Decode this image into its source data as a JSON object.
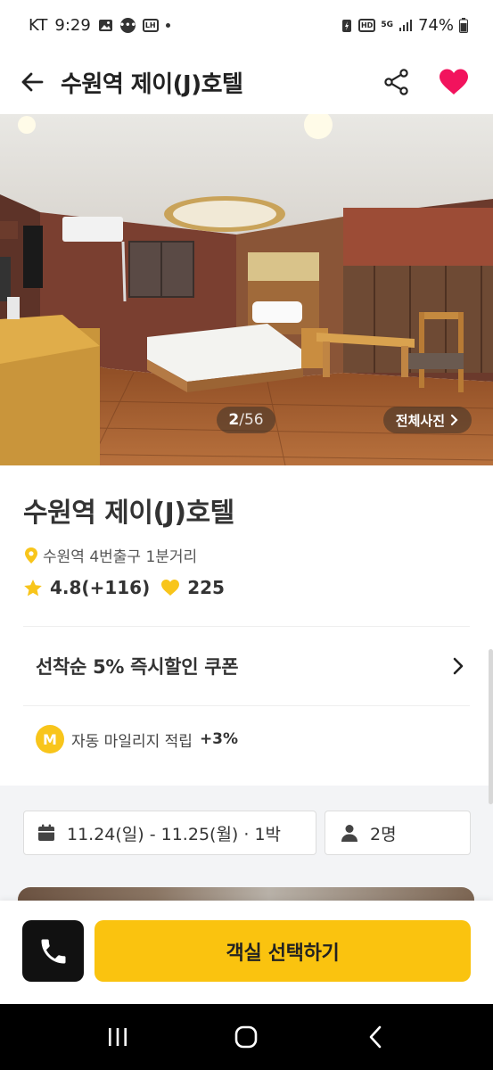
{
  "status_bar": {
    "carrier": "KT",
    "time": "9:29",
    "lh_badge": "LH",
    "hd_badge": "HD",
    "network": "5G",
    "battery": "74%"
  },
  "header": {
    "title": "수원역 제이(J)호텔",
    "favorite_color": "#f2135d"
  },
  "gallery": {
    "current": "2",
    "total": "/56",
    "view_all_label": "전체사진"
  },
  "hotel": {
    "name": "수원역 제이(J)호텔",
    "location": "수원역 4번출구 1분거리",
    "rating": "4.8(+116)",
    "likes": "225"
  },
  "coupon": {
    "label": "선착순 5% 즉시할인 쿠폰"
  },
  "mileage": {
    "badge": "M",
    "label": "자동 마일리지 적립",
    "value": "+3%"
  },
  "booking": {
    "dates": "11.24(일) - 11.25(월) · 1박",
    "guests": "2명"
  },
  "bottom": {
    "select_room_label": "객실 선택하기",
    "accent_color": "#fac30f"
  }
}
